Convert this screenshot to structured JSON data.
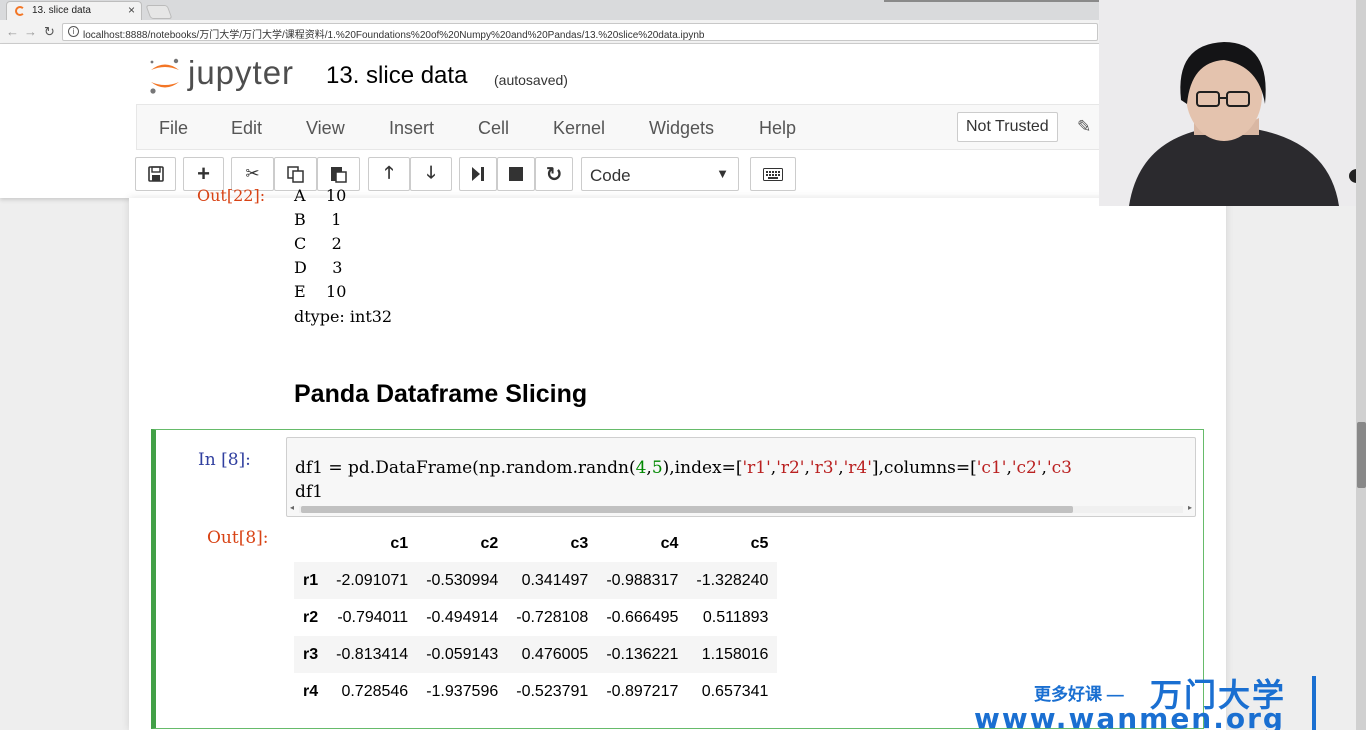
{
  "browser": {
    "tab_title": "13. slice data",
    "tab_close": "×",
    "url": "localhost:8888/notebooks/万门大学/万门大学/课程资料/1.%20Foundations%20of%20Numpy%20and%20Pandas/13.%20slice%20data.ipynb"
  },
  "header": {
    "logo_text": "jupyter",
    "notebook_title": "13. slice data",
    "autosave_status": "(autosaved)"
  },
  "menu": {
    "items": [
      "File",
      "Edit",
      "View",
      "Insert",
      "Cell",
      "Kernel",
      "Widgets",
      "Help"
    ],
    "trust_label": "Not Trusted"
  },
  "toolbar": {
    "cell_type": "Code"
  },
  "previous_output": {
    "prompt": "Out[22]:",
    "lines": [
      "A    10",
      "B     1",
      "C     2",
      "D     3",
      "E    10",
      "dtype: int32"
    ]
  },
  "markdown": {
    "heading": "Panda Dataframe Slicing"
  },
  "cell": {
    "in_prompt": "In  [8]:",
    "code_line1": "df1 = pd.DataFrame(np.random.randn(4,5),index=['r1','r2','r3','r4'],columns=['c1','c2','c3",
    "code_line2": "df1",
    "out_prompt": "Out[8]:"
  },
  "dataframe": {
    "columns": [
      "c1",
      "c2",
      "c3",
      "c4",
      "c5"
    ],
    "rows": [
      {
        "index": "r1",
        "values": [
          "-2.091071",
          "-0.530994",
          "0.341497",
          "-0.988317",
          "-1.328240"
        ]
      },
      {
        "index": "r2",
        "values": [
          "-0.794011",
          "-0.494914",
          "-0.728108",
          "-0.666495",
          "0.511893"
        ]
      },
      {
        "index": "r3",
        "values": [
          "-0.813414",
          "-0.059143",
          "0.476005",
          "-0.136221",
          "1.158016"
        ]
      },
      {
        "index": "r4",
        "values": [
          "0.728546",
          "-1.937596",
          "-0.523791",
          "-0.897217",
          "0.657341"
        ]
      }
    ]
  },
  "watermark": {
    "tagline": "更多好课 —",
    "brand": "万门大学",
    "url": "www.wanmen.org"
  },
  "colors": {
    "accent": "#f37626",
    "prompt_in": "#303f9f",
    "prompt_out": "#d84315",
    "selected_cell": "#42a047",
    "watermark": "#1a6fd1"
  }
}
